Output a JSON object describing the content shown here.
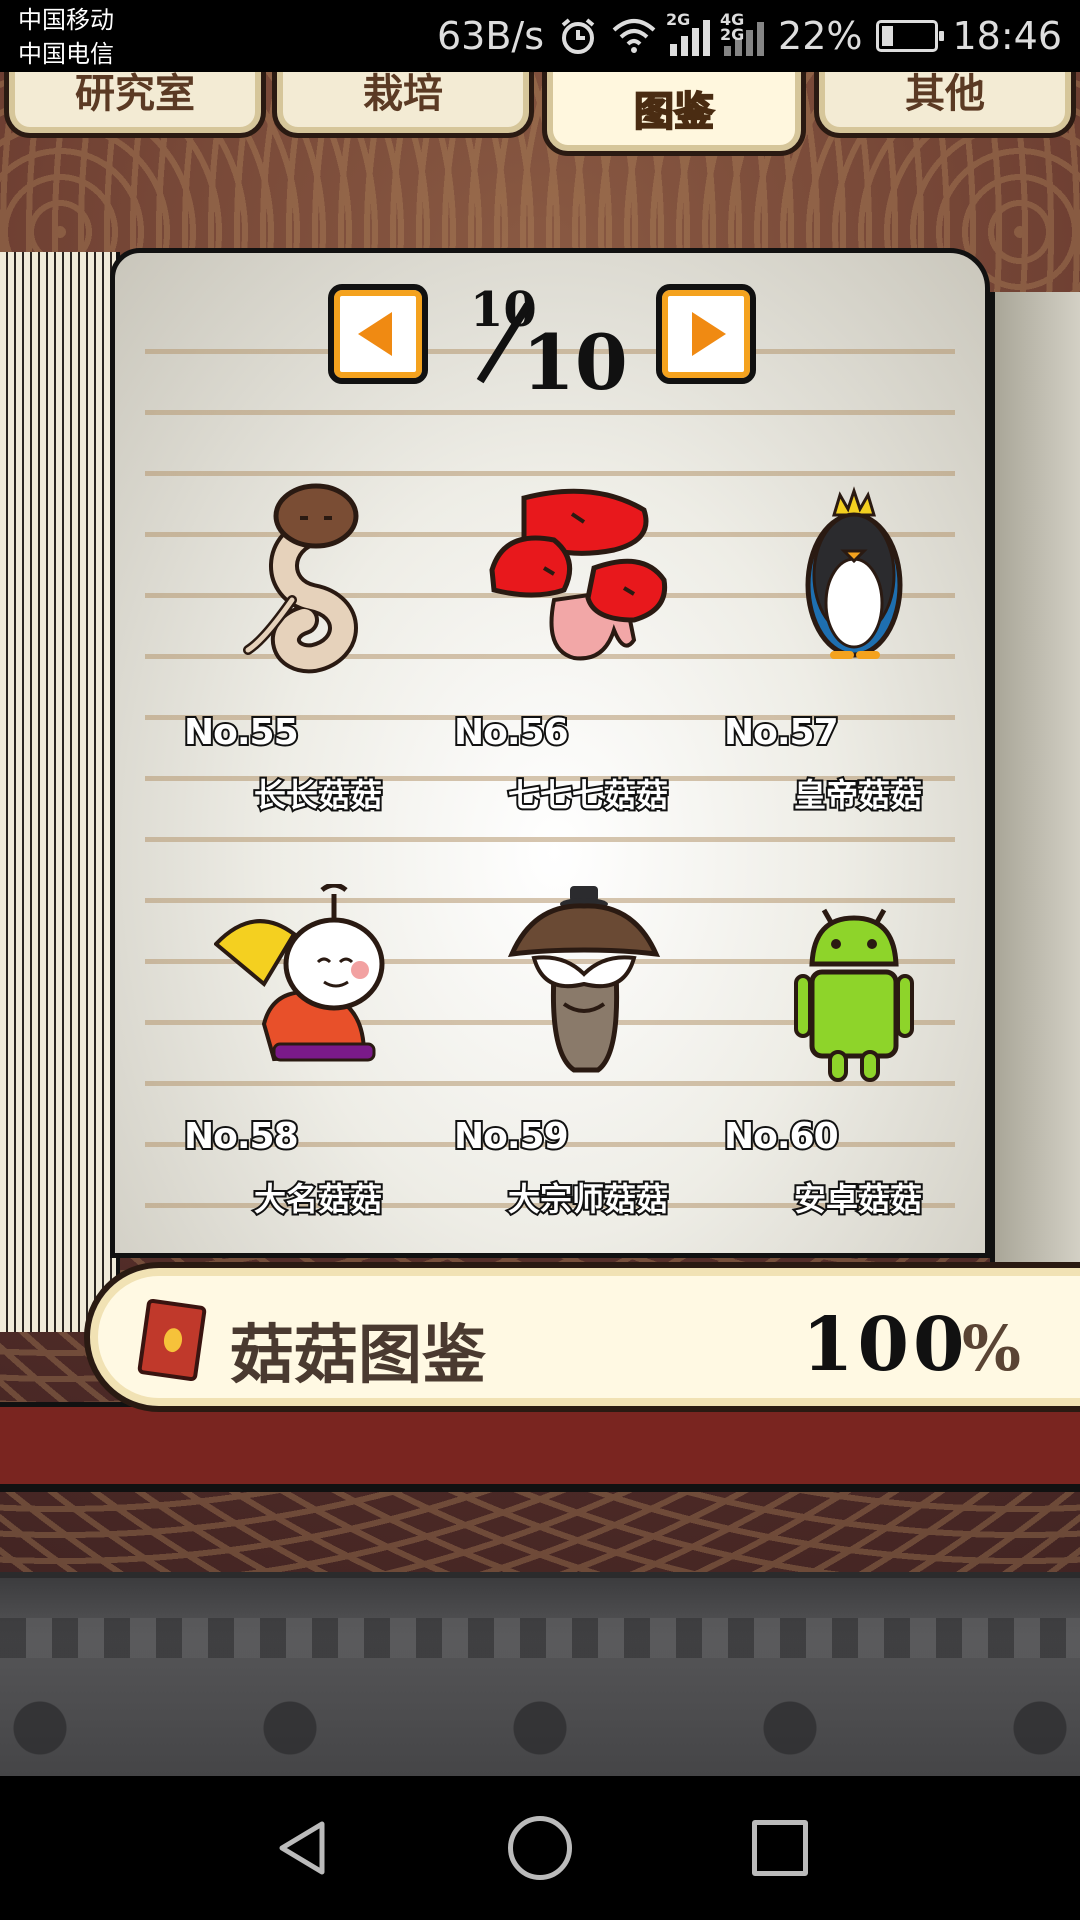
{
  "status_bar": {
    "carrier1": "中国移动",
    "carrier2": "中国电信",
    "net_speed": "63B/s",
    "signal1_tag": "2G",
    "signal2_tag": "4G 2G",
    "battery_pct": "22%",
    "battery_level": 0.22,
    "time": "18:46",
    "icons": [
      "alarm-icon",
      "wifi-icon",
      "signal-icon",
      "battery-icon"
    ]
  },
  "tabs": [
    {
      "label": "研究室",
      "active": false
    },
    {
      "label": "栽培",
      "active": false
    },
    {
      "label": "图鉴",
      "active": true
    },
    {
      "label": "其他",
      "active": false
    }
  ],
  "pager": {
    "current": "10",
    "total": "10"
  },
  "entries": [
    {
      "no": "No.55",
      "name": "长长菇菇",
      "icon": "long-mushroom-icon"
    },
    {
      "no": "No.56",
      "name": "七七七菇菇",
      "icon": "red-triple-mushroom-icon"
    },
    {
      "no": "No.57",
      "name": "皇帝菇菇",
      "icon": "emperor-penguin-icon"
    },
    {
      "no": "No.58",
      "name": "大名菇菇",
      "icon": "daimyo-fan-icon"
    },
    {
      "no": "No.59",
      "name": "大宗师菇菇",
      "icon": "grandmaster-mushroom-icon"
    },
    {
      "no": "No.60",
      "name": "安卓菇菇",
      "icon": "android-robot-icon"
    }
  ],
  "progress": {
    "label": "菇菇图鉴",
    "value": "100",
    "sign": "%",
    "fraction": 1.0
  }
}
